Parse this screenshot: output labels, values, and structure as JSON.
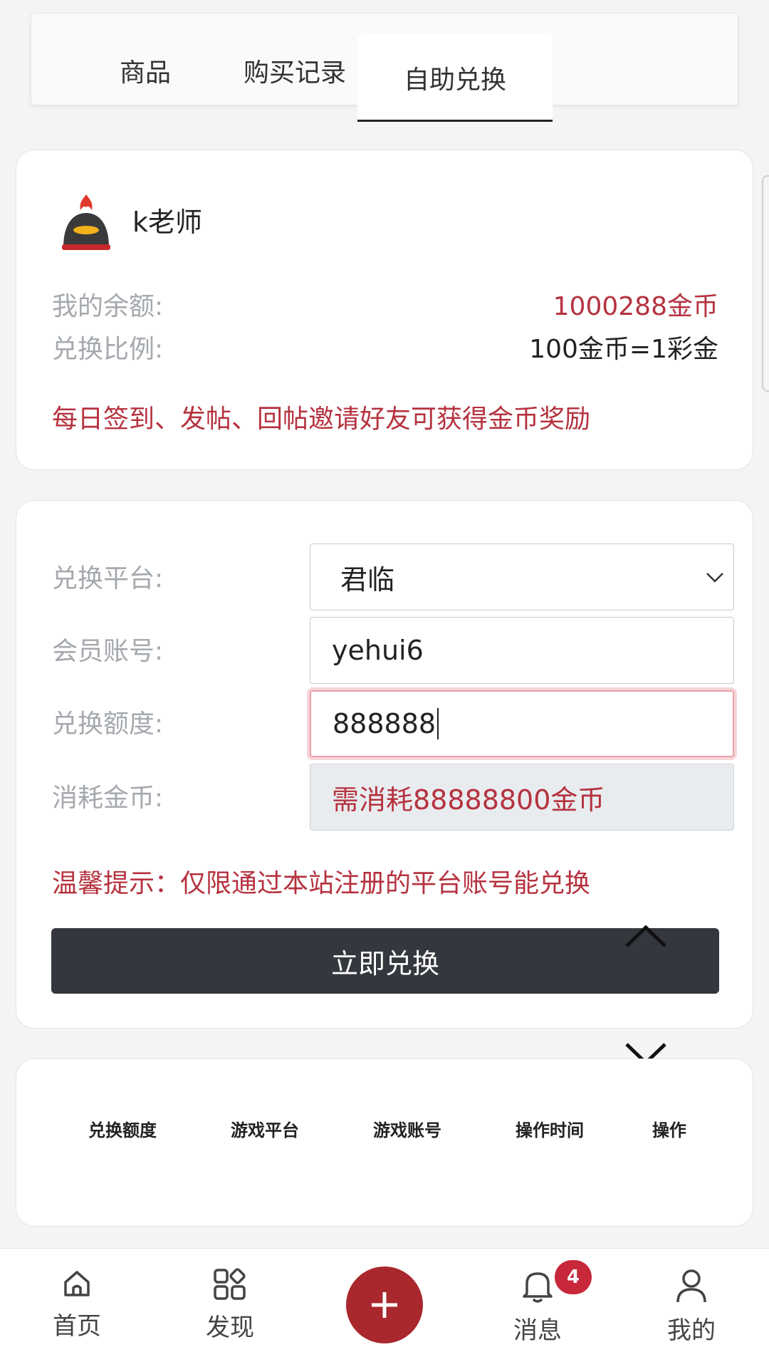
{
  "tabs": [
    {
      "label": "商品"
    },
    {
      "label": "购买记录"
    },
    {
      "label": "自助兑换"
    }
  ],
  "profile": {
    "username": "k老师",
    "balance_label": "我的余额:",
    "balance_value": "1000288金币",
    "ratio_label": "兑换比例:",
    "ratio_value": "100金币=1彩金",
    "promo_text": "每日签到、发帖、回帖邀请好友可获得金币奖励"
  },
  "form": {
    "platform_label": "兑换平台:",
    "platform_value": "君临",
    "account_label": "会员账号:",
    "account_value": "yehui6",
    "amount_label": "兑换额度:",
    "amount_value": "888888",
    "cost_label": "消耗金币:",
    "cost_value": "需消耗88888800金币",
    "tip": "温馨提示：仅限通过本站注册的平台账号能兑换",
    "submit_label": "立即兑换"
  },
  "table": {
    "headers": [
      "兑换额度",
      "游戏平台",
      "游戏账号",
      "操作时间",
      "操作"
    ]
  },
  "bottom_nav": {
    "home": "首页",
    "discover": "发现",
    "messages": "消息",
    "messages_badge": "4",
    "mine": "我的"
  },
  "colors": {
    "accent": "#b5323f",
    "button_dark": "#34373d"
  },
  "icons": [
    "home-icon",
    "grid-icon",
    "plus-icon",
    "bell-icon",
    "user-icon",
    "chevron-up-icon",
    "chevron-down-icon",
    "chevron-down-select-icon"
  ]
}
